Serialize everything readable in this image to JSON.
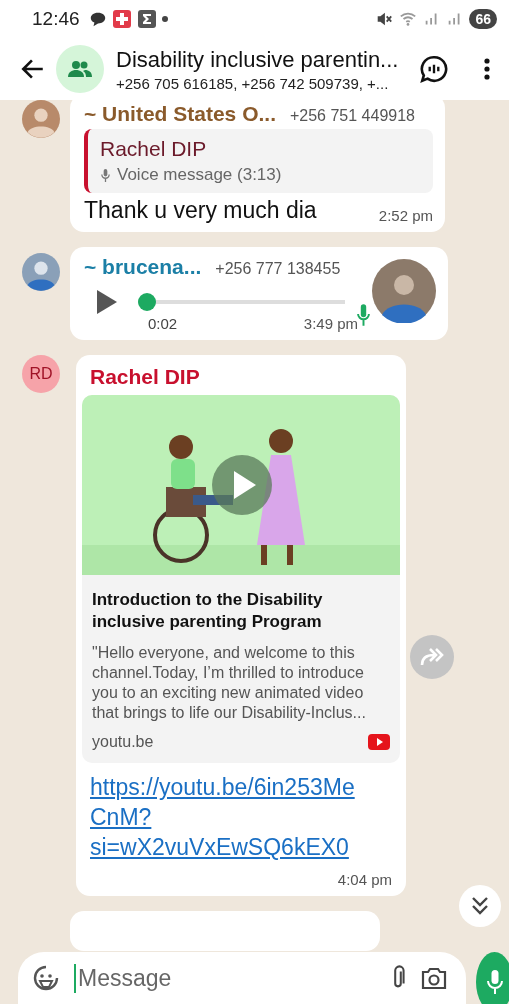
{
  "status_bar": {
    "time": "12:46",
    "battery": "66"
  },
  "header": {
    "title": "Disability inclusive parentin...",
    "subtitle": "+256 705 616185, +256 742 509739, +..."
  },
  "messages": [
    {
      "kind": "reply",
      "sender": "~ United States O...",
      "phone": "+256 751 449918",
      "quote": {
        "sender": "Rachel DIP",
        "text": "Voice message (3:13)"
      },
      "text": "Thank u very much dia",
      "time": "2:52 pm"
    },
    {
      "kind": "voice",
      "sender": "~ brucena...",
      "phone": "+256 777 138455",
      "duration": "0:02",
      "level": 0,
      "time": "3:49 pm"
    },
    {
      "kind": "link",
      "avatar_initials": "RD",
      "sender": "Rachel DIP",
      "preview": {
        "kind": "picture",
        "title": "Introduction to the Disability inclusive parenting Program",
        "description": "\"Hello everyone, and welcome to this channel.Today, I’m thrilled to introduce you to an exciting new animated video that brings to life our Disability-Inclus...",
        "domain": "youtu.be"
      },
      "url": "https://youtu.be/6in253MeCnM?si=wX2vuVxEwSQ6kEX0",
      "time": "4:04 pm"
    },
    {
      "kind": "cut"
    }
  ],
  "composer": {
    "placeholder": "Message"
  }
}
